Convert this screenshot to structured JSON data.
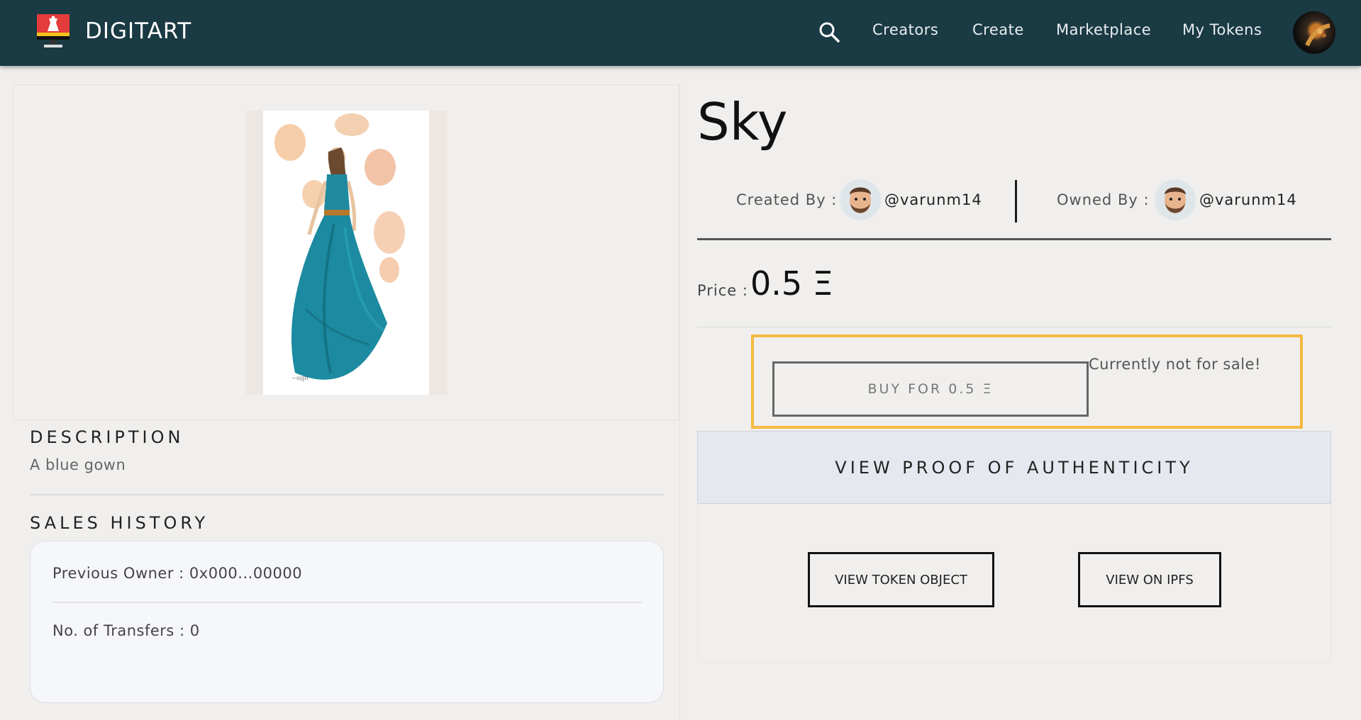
{
  "nav": {
    "brand": "DIGITART",
    "links": [
      "Creators",
      "Create",
      "Marketplace",
      "My Tokens"
    ],
    "icons": {
      "logo": "monitor-art-logo",
      "search": "search-icon",
      "avatar": "user-avatar"
    }
  },
  "description": {
    "heading": "DESCRIPTION",
    "text": "A blue gown"
  },
  "sales_history": {
    "heading": "SALES HISTORY",
    "previous_owner": "Previous Owner : 0x000...00000",
    "transfers": "No. of Transfers : 0"
  },
  "token": {
    "title": "Sky",
    "created_by_label": "Created By :",
    "creator": "@varunm14",
    "owned_by_label": "Owned By :",
    "owner": "@varunm14",
    "price_label": "Price :",
    "price": "0.5 Ξ"
  },
  "actions": {
    "buy": "BUY FOR 0.5 Ξ",
    "not_for_sale": "Currently not for sale!",
    "proof": "VIEW PROOF OF AUTHENTICITY",
    "token_object": "VIEW TOKEN OBJECT",
    "ipfs": "VIEW ON IPFS"
  },
  "colors": {
    "navbar": "#1a3a44",
    "highlight": "#f5b942",
    "proof_bg": "#e6e8ef",
    "page_bg": "#f0efed"
  }
}
